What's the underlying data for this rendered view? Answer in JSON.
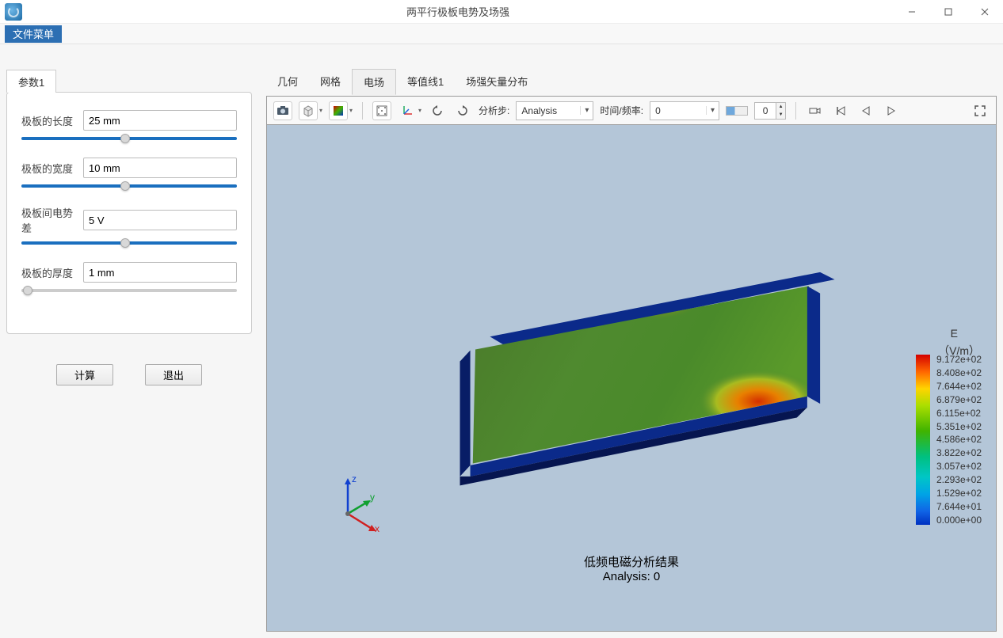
{
  "titlebar": {
    "title": "两平行极板电势及场强"
  },
  "menubar": {
    "file_menu": "文件菜单"
  },
  "sidebar": {
    "tab": "参数1",
    "params": [
      {
        "label": "极板的长度",
        "value": "25 mm",
        "thumb_pct": 48
      },
      {
        "label": "极板的宽度",
        "value": "10 mm",
        "thumb_pct": 48
      },
      {
        "label": "极板间电势差",
        "value": "5 V",
        "thumb_pct": 48
      },
      {
        "label": "极板的厚度",
        "value": "1 mm",
        "thumb_pct": 3
      }
    ],
    "btn_calc": "计算",
    "btn_exit": "退出"
  },
  "main_tabs": [
    "几何",
    "网格",
    "电场",
    "等值线1",
    "场强矢量分布"
  ],
  "active_tab_index": 2,
  "toolbar": {
    "step_label": "分析步:",
    "step_value": "Analysis",
    "time_label": "时间/频率:",
    "time_value": "0",
    "frame_value": "0"
  },
  "viewer": {
    "legend_title": "E",
    "legend_unit": "（V/m）",
    "legend_values": [
      "9.172e+02",
      "8.408e+02",
      "7.644e+02",
      "6.879e+02",
      "6.115e+02",
      "5.351e+02",
      "4.586e+02",
      "3.822e+02",
      "3.057e+02",
      "2.293e+02",
      "1.529e+02",
      "7.644e+01",
      "0.000e+00"
    ],
    "footer_line1": "低频电磁分析结果",
    "footer_line2": "Analysis: 0",
    "axes": {
      "x": "x",
      "y": "y",
      "z": "z"
    },
    "accent_blue": "#0b2a8a",
    "plate_green": "#4b8b2e"
  }
}
